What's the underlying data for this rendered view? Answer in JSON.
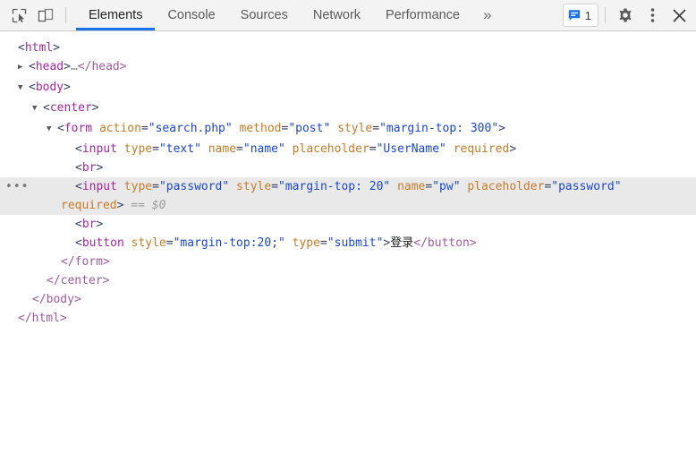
{
  "toolbar": {
    "inspect_icon": "inspect-cursor-icon",
    "device_icon": "device-toolbar-icon",
    "tabs": [
      {
        "label": "Elements",
        "active": true
      },
      {
        "label": "Console",
        "active": false
      },
      {
        "label": "Sources",
        "active": false
      },
      {
        "label": "Network",
        "active": false
      },
      {
        "label": "Performance",
        "active": false
      }
    ],
    "more_tabs_label": "»",
    "message_icon": "message-bubble-icon",
    "message_count": "1",
    "settings_icon": "gear-icon",
    "kebab_icon": "more-vertical-icon",
    "close_icon": "close-icon",
    "accent_color": "#1a73e8",
    "badge_icon_color": "#1a73e8"
  },
  "dom": {
    "html_open_lt": "<",
    "html_open_tag": "html",
    "html_open_gt": ">",
    "head_tag": "head",
    "head_ellipsis": "…",
    "head_close": "</head>",
    "body_tag": "body",
    "center_tag": "center",
    "form_tag": "form",
    "form_attr1_name": "action",
    "form_attr1_value": "search.php",
    "form_attr2_name": "method",
    "form_attr2_value": "post",
    "form_attr3_name": "style",
    "form_attr3_value": "margin-top: 300",
    "input1_tag": "input",
    "input1_attr1_name": "type",
    "input1_attr1_value": "text",
    "input1_attr2_name": "name",
    "input1_attr2_value": "name",
    "input1_attr3_name": "placeholder",
    "input1_attr3_value": "UserName",
    "input1_attr4_name": "required",
    "br1_tag": "br",
    "input2_gutter": "•••",
    "input2_tag": "input",
    "input2_attr1_name": "type",
    "input2_attr1_value": "password",
    "input2_attr2_name": "style",
    "input2_attr2_value": "margin-top: 20",
    "input2_attr3_name": "name",
    "input2_attr3_value": "pw",
    "input2_attr4_name": "placeholder",
    "input2_attr4_value": "password",
    "input2_attr5_name": "required",
    "input2_selected_ref": "== $0",
    "br2_tag": "br",
    "button_tag": "button",
    "button_attr1_name": "style",
    "button_attr1_value": "margin-top:20;",
    "button_attr2_name": "type",
    "button_attr2_value": "submit",
    "button_text": "登录",
    "button_close": "</button>",
    "form_close": "</form>",
    "center_close": "</center>",
    "body_close": "</body>",
    "html_close": "</html>",
    "twisty_collapsed": "▶",
    "twisty_expanded": "▼"
  }
}
